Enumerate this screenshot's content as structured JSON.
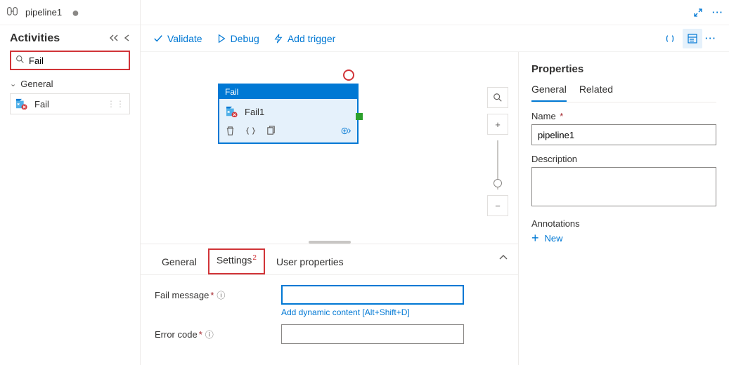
{
  "tab": {
    "label": "pipeline1",
    "dirty": "●"
  },
  "sidebar": {
    "title": "Activities",
    "search_value": "Fail",
    "category": "General",
    "items": [
      {
        "label": "Fail"
      }
    ]
  },
  "toolbar": {
    "validate": "Validate",
    "debug": "Debug",
    "add_trigger": "Add trigger"
  },
  "node": {
    "type_label": "Fail",
    "name": "Fail1"
  },
  "bottom_tabs": {
    "general": "General",
    "settings": "Settings",
    "settings_badge": "2",
    "user_props": "User properties"
  },
  "settings_form": {
    "fail_message_label": "Fail message",
    "fail_message_value": "",
    "dyn_link": "Add dynamic content [Alt+Shift+D]",
    "error_code_label": "Error code",
    "error_code_value": ""
  },
  "properties": {
    "title": "Properties",
    "tab_general": "General",
    "tab_related": "Related",
    "name_label": "Name",
    "name_value": "pipeline1",
    "desc_label": "Description",
    "desc_value": "",
    "ann_label": "Annotations",
    "new_label": "New"
  }
}
